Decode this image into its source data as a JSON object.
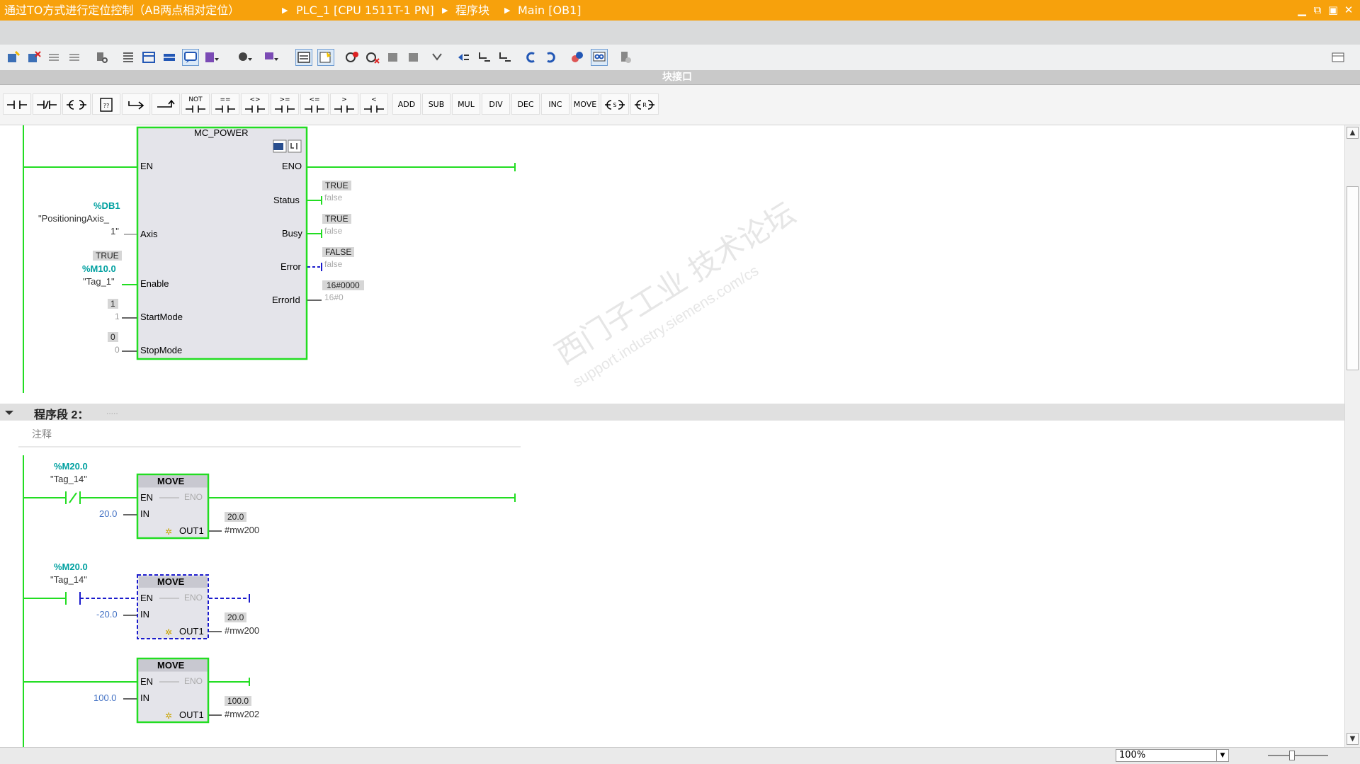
{
  "titlebar": {
    "crumbs": [
      "通过TO方式进行定位控制（AB两点相对定位）",
      "PLC_1 [CPU 1511T-1 PN]",
      "程序块",
      "Main [OB1]"
    ],
    "separator": "▶",
    "win_minimize": "▁",
    "win_restore": "⧉",
    "win_maximize": "▣",
    "win_close": "✕"
  },
  "interface_bar": {
    "label": "块接口"
  },
  "instructions": [
    "NOT",
    "ADD",
    "SUB",
    "MUL",
    "DIV",
    "DEC",
    "INC",
    "MOVE"
  ],
  "network1": {
    "block": {
      "name": "MC_POWER",
      "pins_in": [
        "EN",
        "Axis",
        "Enable",
        "StartMode",
        "StopMode"
      ],
      "pins_out": [
        "ENO",
        "Status",
        "Busy",
        "Error",
        "ErrorId"
      ]
    },
    "axis_addr": "%DB1",
    "axis_name_1": "\"PositioningAxis_",
    "axis_name_2": "1\"",
    "enable_monitor": "TRUE",
    "enable_addr": "%M10.0",
    "enable_name": "\"Tag_1\"",
    "startmode_monitor": "1",
    "startmode_value": "1",
    "stopmode_monitor": "0",
    "stopmode_value": "0",
    "status_monitor": "TRUE",
    "status_value": "false",
    "busy_monitor": "TRUE",
    "busy_value": "false",
    "error_monitor": "FALSE",
    "error_value": "false",
    "errorid_monitor": "16#0000",
    "errorid_value": "16#0"
  },
  "network2": {
    "title": "程序段 2：",
    "title_dots": ".....",
    "comment": "注释",
    "rung1": {
      "addr": "%M20.0",
      "name": "\"Tag_14\"",
      "block": "MOVE",
      "en": "EN",
      "eno": "ENO",
      "in": "IN",
      "out": "OUT1",
      "in_value": "20.0",
      "out_monitor": "20.0",
      "out_var": "#mw200"
    },
    "rung2": {
      "addr": "%M20.0",
      "name": "\"Tag_14\"",
      "block": "MOVE",
      "en": "EN",
      "eno": "ENO",
      "in": "IN",
      "out": "OUT1",
      "in_value": "-20.0",
      "out_monitor": "20.0",
      "out_var": "#mw200"
    },
    "rung3": {
      "block": "MOVE",
      "en": "EN",
      "eno": "ENO",
      "in": "IN",
      "out": "OUT1",
      "in_value": "100.0",
      "out_monitor": "100.0",
      "out_var": "#mw202"
    }
  },
  "watermark": {
    "line1": "西门子工业 技术论坛",
    "line2": "support.industry.siemens.com/cs"
  },
  "bottom": {
    "zoom": "100%"
  },
  "colors": {
    "title_bg": "#f7a10c",
    "power_flow": "#22dd22",
    "address": "#00a0a0",
    "literal": "#4472c4",
    "selected": "#1a1acc"
  }
}
